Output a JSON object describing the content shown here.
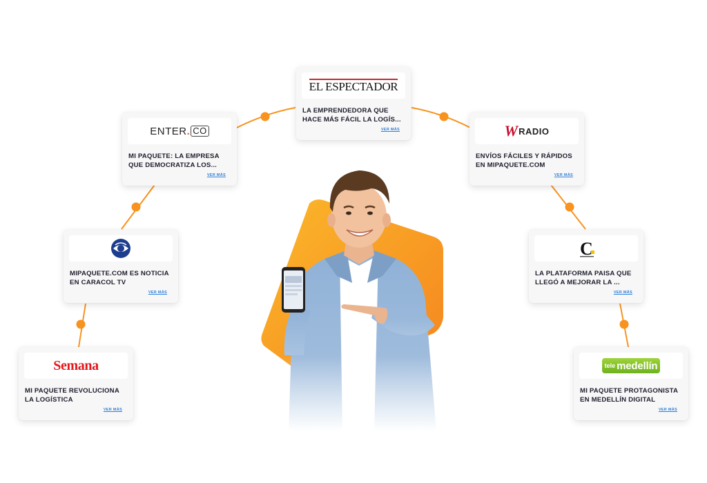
{
  "colors": {
    "accent": "#f7931e",
    "link": "#2f7fd8",
    "card_bg": "#f7f7f8"
  },
  "cards": {
    "espectador": {
      "logo_text": "EL ESPECTADOR",
      "headline": "LA EMPRENDEDORA QUE HACE MÁS FÁCIL LA LOGÍS...",
      "more": "VER MÁS"
    },
    "enter": {
      "logo_text": "ENTER",
      "logo_suffix": "CO",
      "headline": "MI PAQUETE: LA EMPRESA QUE DEMOCRATIZA LOS...",
      "more": "VER MÁS"
    },
    "wradio": {
      "logo_text": "W",
      "logo_suffix": "RADIO",
      "headline": "ENVÍOS FÁCILES Y RÁPIDOS EN MIPAQUETE.COM",
      "more": "VER MÁS"
    },
    "caracol": {
      "logo_icon": "caracol-eye-icon",
      "headline": "MIPAQUETE.COM ES NOTICIA EN CARACOL TV",
      "more": "VER MÁS"
    },
    "colombiano": {
      "logo_icon": "el-colombiano-c-icon",
      "headline": "LA PLATAFORMA PAISA QUE LLEGÓ A MEJORAR LA ...",
      "more": "VER MÁS"
    },
    "semana": {
      "logo_text": "Semana",
      "headline": "MI PAQUETE REVOLUCIONA LA LOGÍSTICA",
      "more": "VER MÁS"
    },
    "telemedellin": {
      "logo_text": "tele",
      "logo_suffix": "medellín",
      "headline": "MI PAQUETE PROTAGONISTA EN MEDELLÍN DIGITAL",
      "more": "VER MÁS"
    }
  }
}
